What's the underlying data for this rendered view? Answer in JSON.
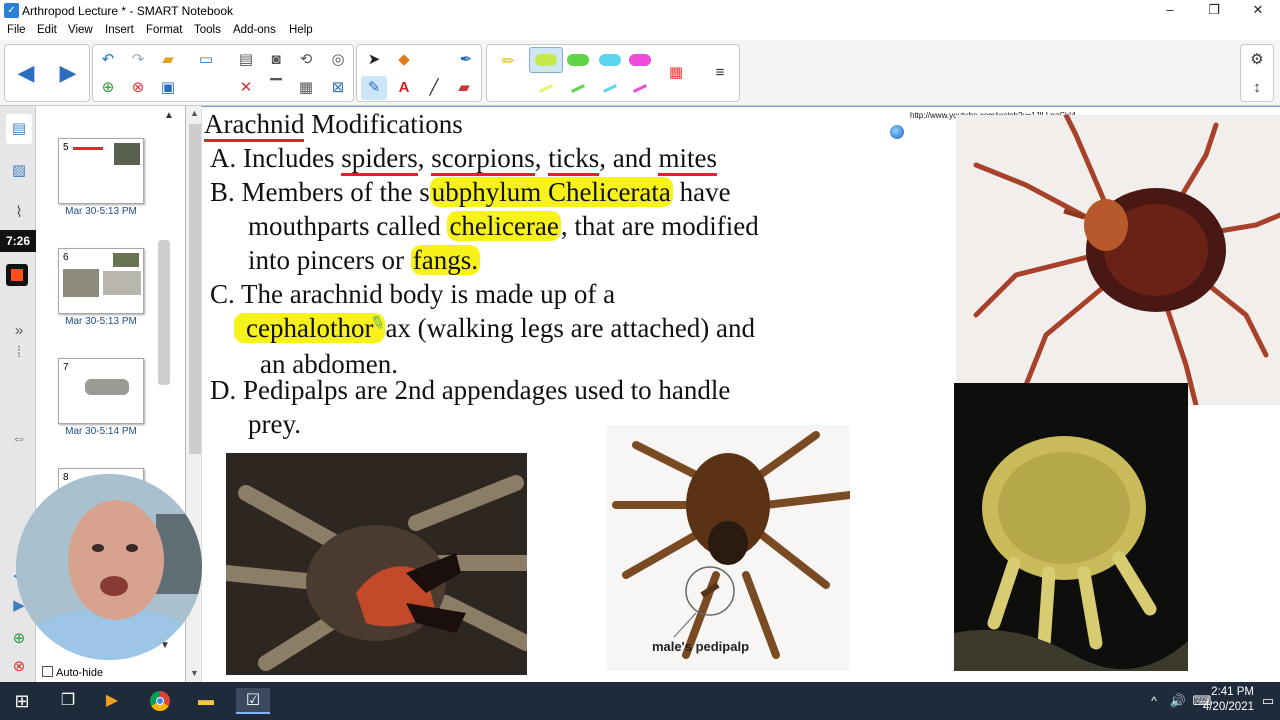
{
  "window": {
    "title": "Arthropod Lecture * - SMART Notebook",
    "app_icon": "smart-notebook-icon"
  },
  "menu": [
    "File",
    "Edit",
    "View",
    "Insert",
    "Format",
    "Tools",
    "Add-ons",
    "Help"
  ],
  "timer": "7:26",
  "sorter": {
    "pages": [
      {
        "num": "5",
        "date": "Mar 30-5:13 PM"
      },
      {
        "num": "6",
        "date": "Mar 30-5:13 PM"
      },
      {
        "num": "7",
        "date": "Mar 30-5:14 PM"
      },
      {
        "num": "8",
        "date": ""
      }
    ],
    "auto_hide": "Auto-hide"
  },
  "slide": {
    "title_word": "Arachnid",
    "title_rest": "Modifications",
    "link": "http://www.youtube.com/watch?v=1JlLLpaCkI4",
    "lineA_1": "A.  Includes",
    "lineA_spiders": "spiders",
    "lineA_c1": ",",
    "lineA_scorpions": "scorpions",
    "lineA_c2": ",",
    "lineA_ticks": "ticks",
    "lineA_c3": ", and",
    "lineA_mites": "mites",
    "lineB_1": "B.  Members of the s",
    "lineB_hl": "ubphylum Chelicerata",
    "lineB_2": " have",
    "lineB2_1": "mouthparts called ",
    "lineB2_hl": "chelicerae",
    "lineB2_2": ", that are modified",
    "lineB3_1": "into pincers or ",
    "lineB3_hl": "fangs.",
    "lineC_1": "C.  The arachnid body is made up of a",
    "lineC2_hl": "cephalothor",
    "lineC2_2": "ax (walking legs are attached) and",
    "lineC3": "an abdomen.",
    "lineD_1": "D.  Pedipalps are 2nd appendages used to handle",
    "lineD_2": "prey.",
    "caption": "male's pedipalp"
  },
  "taskbar": {
    "time": "2:41 PM",
    "date": "4/20/2021"
  },
  "colors": {
    "highlight": "#f7f21a",
    "underline": "#e2202a",
    "taskbar": "#1f2a3a"
  }
}
